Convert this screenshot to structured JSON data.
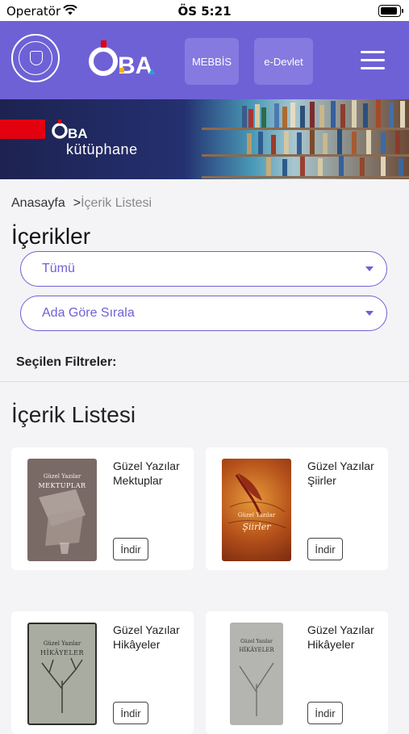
{
  "status_bar": {
    "carrier": "Operatör",
    "time": "ÖS 5:21"
  },
  "header": {
    "logo": "ÖBA",
    "buttons": [
      "MEBBİS",
      "e-Devlet"
    ]
  },
  "banner": {
    "logo": "ÖBA",
    "subtitle": "kütüphane"
  },
  "breadcrumb": {
    "home": "Anasayfa",
    "separator": ">",
    "current": "İçerik Listesi"
  },
  "page_title": "İçerikler",
  "filters": {
    "category": "Tümü",
    "sort": "Ada Göre Sırala",
    "selected_label": "Seçilen Filtreler:"
  },
  "list_title": "İçerik Listesi",
  "items": [
    {
      "title": "Güzel Yazılar Mektuplar",
      "button": "İndir",
      "cover": {
        "top": "Güzel Yazılar",
        "main": "MEKTUPLAR"
      }
    },
    {
      "title": "Güzel Yazılar Şiirler",
      "button": "İndir",
      "cover": {
        "top": "Güzel Yazılar",
        "main": "Şiirler"
      }
    },
    {
      "title": "Güzel Yazılar Hikâyeler",
      "button": "İndir",
      "cover": {
        "top": "Güzel Yazılar",
        "main": "HİKÂYELER"
      }
    },
    {
      "title": "Güzel Yazılar Hikâyeler",
      "button": "İndir",
      "cover": {
        "top": "Güzel Yazılar",
        "main": "HİKÂYELER"
      }
    }
  ],
  "colors": {
    "brand": "#6e61d6",
    "brand_light": "#8679e0",
    "red": "#e3000f"
  },
  "icons": {
    "wifi": "wifi-icon",
    "battery": "battery-icon",
    "menu": "hamburger-menu-icon",
    "caret": "chevron-down-icon"
  }
}
